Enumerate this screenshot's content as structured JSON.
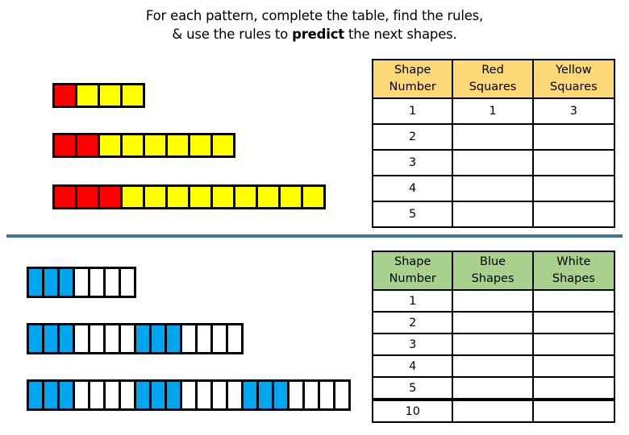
{
  "instructions": {
    "line1": "For each pattern, complete the table, find the rules,",
    "line2_pre": "& use the rules to ",
    "line2_bold": "predict",
    "line2_post": " the next shapes."
  },
  "colors": {
    "red": "#ff0000",
    "yellow": "#ffff00",
    "blue": "#00a6ed",
    "white": "#ffffff",
    "table1_header": "#fcd877",
    "table2_header": "#a9d18e",
    "divider": "#3e74a0"
  },
  "pattern1": {
    "shapes": [
      {
        "red": 1,
        "yellow": 3
      },
      {
        "red": 2,
        "yellow": 6
      },
      {
        "red": 3,
        "yellow": 9
      }
    ]
  },
  "pattern2": {
    "shapes": [
      {
        "groups": 1,
        "blue_per_group": 3,
        "white_per_group": 4
      },
      {
        "groups": 2,
        "blue_per_group": 3,
        "white_per_group": 4
      },
      {
        "groups": 3,
        "blue_per_group": 3,
        "white_per_group": 4
      }
    ]
  },
  "table1": {
    "headers": [
      "Shape Number",
      "Red Squares",
      "Yellow Squares"
    ],
    "header_lines": [
      [
        "Shape",
        "Number"
      ],
      [
        "Red",
        "Squares"
      ],
      [
        "Yellow",
        "Squares"
      ]
    ],
    "rows": [
      [
        "1",
        "1",
        "3"
      ],
      [
        "2",
        "",
        ""
      ],
      [
        "3",
        "",
        ""
      ],
      [
        "4",
        "",
        ""
      ],
      [
        "5",
        "",
        ""
      ]
    ]
  },
  "table2": {
    "headers": [
      "Shape Number",
      "Blue Shapes",
      "White Shapes"
    ],
    "header_lines": [
      [
        "Shape",
        "Number"
      ],
      [
        "Blue",
        "Shapes"
      ],
      [
        "White",
        "Shapes"
      ]
    ],
    "rows": [
      [
        "1",
        "",
        ""
      ],
      [
        "2",
        "",
        ""
      ],
      [
        "3",
        "",
        ""
      ],
      [
        "4",
        "",
        ""
      ],
      [
        "5",
        "",
        ""
      ],
      [
        "10",
        "",
        ""
      ]
    ]
  }
}
